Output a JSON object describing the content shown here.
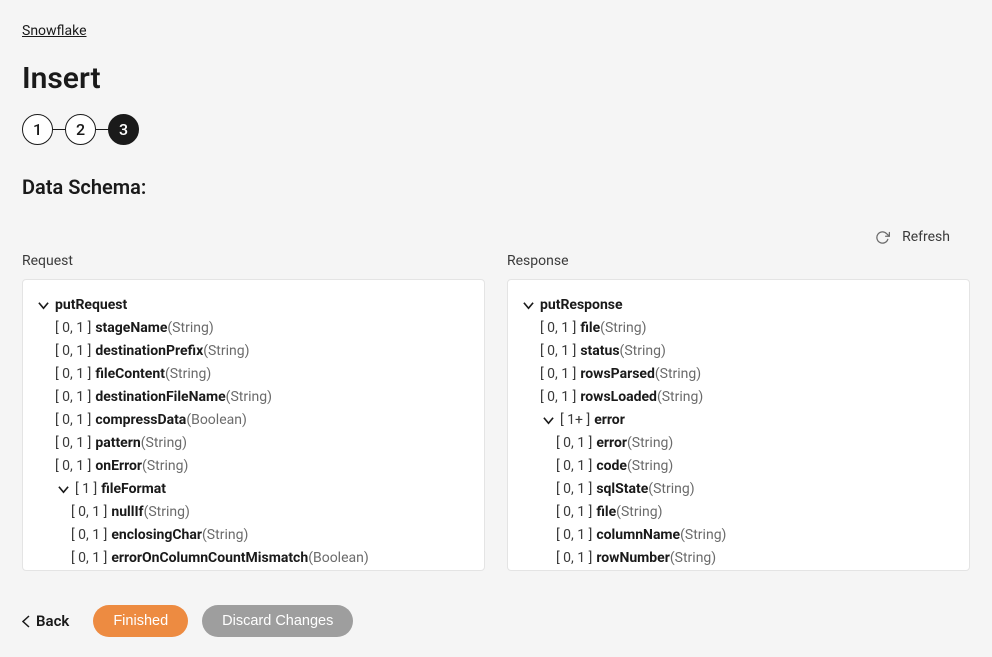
{
  "breadcrumb": {
    "link": "Snowflake"
  },
  "page_title": "Insert",
  "stepper": {
    "steps": [
      "1",
      "2",
      "3"
    ],
    "active_index": 2
  },
  "section_title": "Data Schema:",
  "refresh": {
    "label": "Refresh"
  },
  "request": {
    "header": "Request",
    "tree": [
      {
        "indent": 0,
        "caret": true,
        "card": null,
        "name": "putRequest",
        "type": null
      },
      {
        "indent": 1,
        "caret": false,
        "card": "[ 0, 1 ]",
        "name": "stageName",
        "type": "(String)"
      },
      {
        "indent": 1,
        "caret": false,
        "card": "[ 0, 1 ]",
        "name": "destinationPrefix",
        "type": "(String)"
      },
      {
        "indent": 1,
        "caret": false,
        "card": "[ 0, 1 ]",
        "name": "fileContent",
        "type": "(String)"
      },
      {
        "indent": 1,
        "caret": false,
        "card": "[ 0, 1 ]",
        "name": "destinationFileName",
        "type": "(String)"
      },
      {
        "indent": 1,
        "caret": false,
        "card": "[ 0, 1 ]",
        "name": "compressData",
        "type": "(Boolean)"
      },
      {
        "indent": 1,
        "caret": false,
        "card": "[ 0, 1 ]",
        "name": "pattern",
        "type": "(String)"
      },
      {
        "indent": 1,
        "caret": false,
        "card": "[ 0, 1 ]",
        "name": "onError",
        "type": "(String)"
      },
      {
        "indent": 1,
        "caret": true,
        "card": "[ 1 ]",
        "name": "fileFormat",
        "type": null
      },
      {
        "indent": 2,
        "caret": false,
        "card": "[ 0, 1 ]",
        "name": "nullIf",
        "type": "(String)"
      },
      {
        "indent": 2,
        "caret": false,
        "card": "[ 0, 1 ]",
        "name": "enclosingChar",
        "type": "(String)"
      },
      {
        "indent": 2,
        "caret": false,
        "card": "[ 0, 1 ]",
        "name": "errorOnColumnCountMismatch",
        "type": "(Boolean)"
      }
    ]
  },
  "response": {
    "header": "Response",
    "tree": [
      {
        "indent": 0,
        "caret": true,
        "card": null,
        "name": "putResponse",
        "type": null
      },
      {
        "indent": 1,
        "caret": false,
        "card": "[ 0, 1 ]",
        "name": "file",
        "type": "(String)"
      },
      {
        "indent": 1,
        "caret": false,
        "card": "[ 0, 1 ]",
        "name": "status",
        "type": "(String)"
      },
      {
        "indent": 1,
        "caret": false,
        "card": "[ 0, 1 ]",
        "name": "rowsParsed",
        "type": "(String)"
      },
      {
        "indent": 1,
        "caret": false,
        "card": "[ 0, 1 ]",
        "name": "rowsLoaded",
        "type": "(String)"
      },
      {
        "indent": 1,
        "caret": true,
        "card": "[ 1+ ]",
        "name": "error",
        "type": null
      },
      {
        "indent": 2,
        "caret": false,
        "card": "[ 0, 1 ]",
        "name": "error",
        "type": "(String)"
      },
      {
        "indent": 2,
        "caret": false,
        "card": "[ 0, 1 ]",
        "name": "code",
        "type": "(String)"
      },
      {
        "indent": 2,
        "caret": false,
        "card": "[ 0, 1 ]",
        "name": "sqlState",
        "type": "(String)"
      },
      {
        "indent": 2,
        "caret": false,
        "card": "[ 0, 1 ]",
        "name": "file",
        "type": "(String)"
      },
      {
        "indent": 2,
        "caret": false,
        "card": "[ 0, 1 ]",
        "name": "columnName",
        "type": "(String)"
      },
      {
        "indent": 2,
        "caret": false,
        "card": "[ 0, 1 ]",
        "name": "rowNumber",
        "type": "(String)"
      }
    ]
  },
  "footer": {
    "back": "Back",
    "finished": "Finished",
    "discard": "Discard Changes"
  }
}
